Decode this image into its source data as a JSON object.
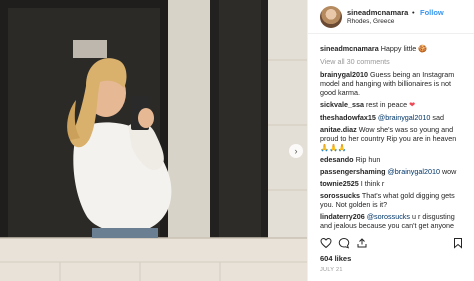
{
  "header": {
    "username": "sineadmcnamara",
    "separator": "•",
    "follow_label": "Follow",
    "location": "Rhodes, Greece"
  },
  "caption": {
    "username": "sineadmcnamara",
    "text": "Happy little",
    "emoji": "cookie-emoji"
  },
  "view_all_label": "View all 30 comments",
  "comments": [
    {
      "username": "brainygal2010",
      "line1": "Guess being an Instagram",
      "line2": "model and hanging with billionaires is not",
      "line3": "good karma."
    },
    {
      "username": "sickvale_ssa",
      "line1": "rest in peace",
      "emoji": "heart-emoji"
    },
    {
      "username": "theshadowfax15",
      "mention": "@brainygal2010",
      "line1": "sad"
    },
    {
      "username": "anitae.diaz",
      "line1": "Wow she's was so young and",
      "line2": "proud to her country Rip you are in heaven",
      "emoji": "clapping-hands-emoji"
    },
    {
      "username": "edesando",
      "line1": "Rip hun"
    },
    {
      "username": "passengershaming",
      "mention": "@brainygal2010",
      "line1": "wow"
    },
    {
      "username": "townie2525",
      "line1": "I think r"
    },
    {
      "username": "sorossucks",
      "line1": "That's what gold digging gets",
      "line2": "you. Not golden is it?"
    },
    {
      "username": "lindaterry206",
      "mention": "@sorossucks",
      "line1": "u r disgusting",
      "line2": "and jealous because you can't get anyone"
    }
  ],
  "actions": {
    "like_icon": "heart-outline-icon",
    "comment_icon": "comment-bubble-icon",
    "share_icon": "share-arrow-icon",
    "save_icon": "bookmark-icon"
  },
  "likes": "604 likes",
  "date": "JULY 21",
  "photo": {
    "alt_subject": "mirror selfie",
    "next_icon": "chevron-right-icon",
    "next_glyph": "›",
    "colors": {
      "wall": "#d8d3c9",
      "door_dark": "#1f1e1c",
      "sweater": "#f4f2ee",
      "hair": "#d9b06c",
      "skin": "#e7b894",
      "phone": "#2a2a2a"
    }
  },
  "colors": {
    "accent": "#3897f0",
    "text": "#262626",
    "muted": "#999999",
    "divider": "#efefef"
  }
}
